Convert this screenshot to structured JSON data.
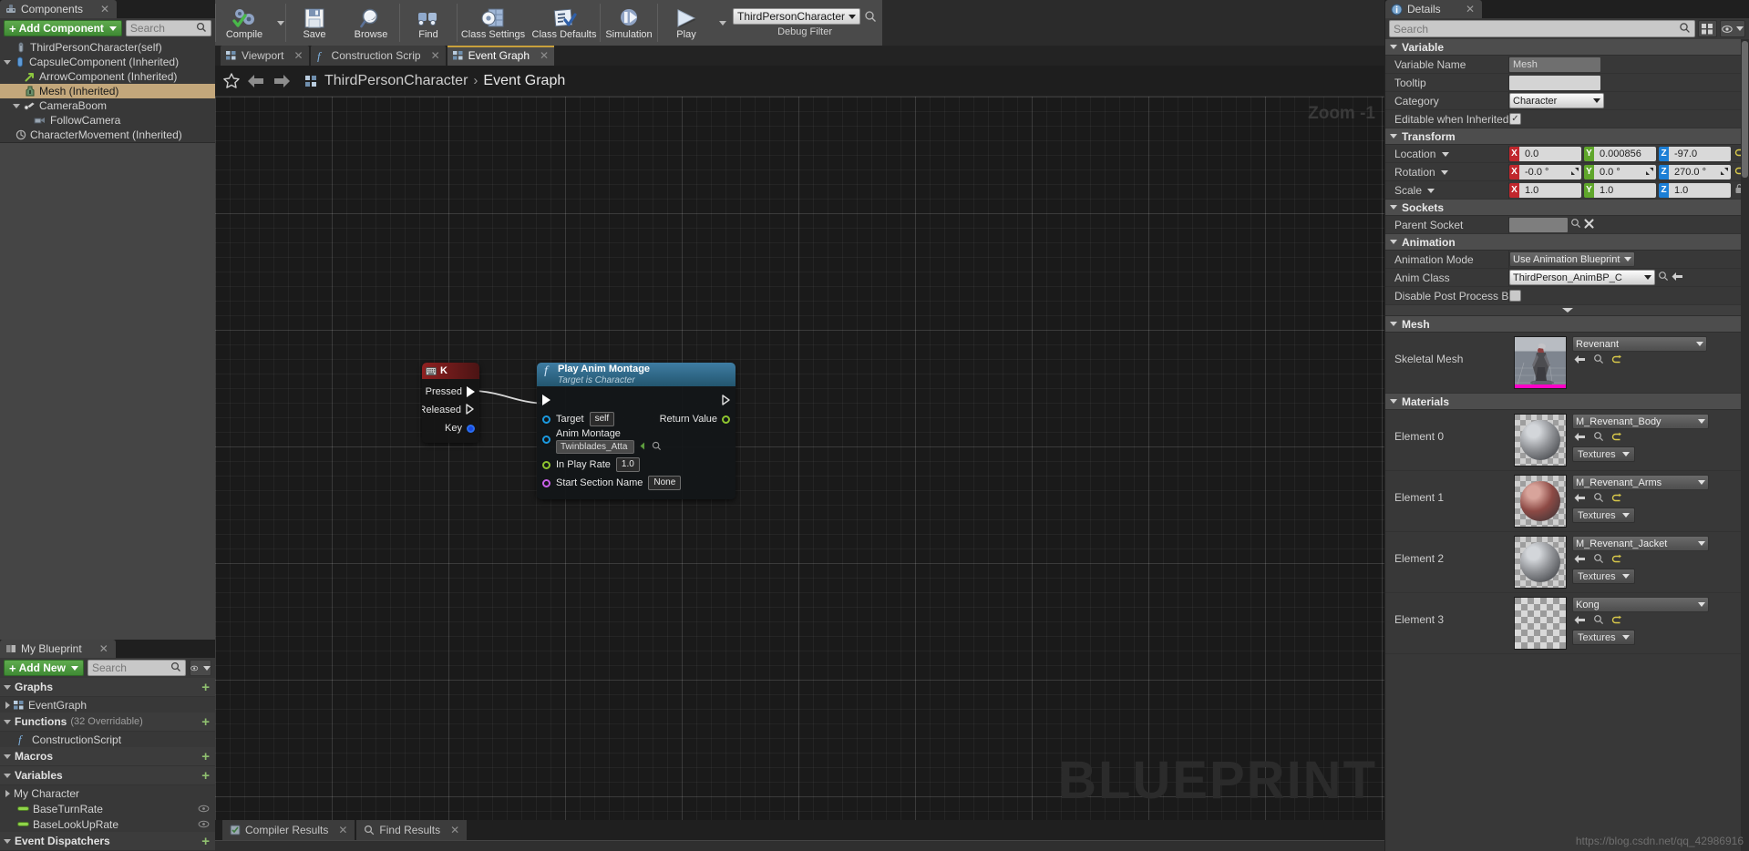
{
  "components_panel": {
    "tab_label": "Components",
    "add_component_label": "Add Component",
    "search_placeholder": "Search",
    "tree": [
      {
        "label": "ThirdPersonCharacter(self)",
        "icon": "blueprint-icon",
        "depth": 0,
        "expander": "none",
        "selected": false
      },
      {
        "label": "CapsuleComponent (Inherited)",
        "icon": "capsule-icon",
        "depth": 0,
        "expander": "down",
        "selected": false
      },
      {
        "label": "ArrowComponent (Inherited)",
        "icon": "arrow-icon",
        "depth": 1,
        "expander": "none",
        "selected": false
      },
      {
        "label": "Mesh (Inherited)",
        "icon": "mesh-icon",
        "depth": 1,
        "expander": "none",
        "selected": true
      },
      {
        "label": "CameraBoom",
        "icon": "spring-arm-icon",
        "depth": 1,
        "expander": "down",
        "selected": false
      },
      {
        "label": "FollowCamera",
        "icon": "camera-icon",
        "depth": 2,
        "expander": "none",
        "selected": false
      },
      {
        "label": "CharacterMovement (Inherited)",
        "icon": "movement-icon",
        "depth": 0,
        "expander": "none",
        "selected": false
      }
    ]
  },
  "my_blueprint_panel": {
    "tab_label": "My Blueprint",
    "add_new_label": "Add New",
    "search_placeholder": "Search",
    "sections": [
      {
        "title": "Graphs",
        "sub": "",
        "items": [
          {
            "label": "EventGraph",
            "icon": "graph-icon",
            "expander": "right",
            "trail": ""
          }
        ]
      },
      {
        "title": "Functions",
        "sub": "(32 Overridable)",
        "items": [
          {
            "label": "ConstructionScript",
            "icon": "function-icon",
            "expander": "none",
            "trail": ""
          }
        ]
      },
      {
        "title": "Macros",
        "sub": "",
        "items": []
      },
      {
        "title": "Variables",
        "sub": "",
        "items": [
          {
            "label": "My Character",
            "icon": "category-icon",
            "expander": "right",
            "trail": "",
            "category": true
          },
          {
            "label": "BaseTurnRate",
            "icon": "float-var-icon",
            "expander": "none",
            "trail": "eye-icon"
          },
          {
            "label": "BaseLookUpRate",
            "icon": "float-var-icon",
            "expander": "none",
            "trail": "eye-icon"
          }
        ]
      },
      {
        "title": "Event Dispatchers",
        "sub": "",
        "items": []
      }
    ]
  },
  "toolbar": {
    "items": [
      {
        "label": "Compile",
        "icon": "compile-icon",
        "has_dropdown": true
      },
      {
        "label": "Save",
        "icon": "save-icon",
        "has_dropdown": false
      },
      {
        "label": "Browse",
        "icon": "browse-icon",
        "has_dropdown": false
      },
      {
        "label": "Find",
        "icon": "find-icon",
        "has_dropdown": false
      },
      {
        "label": "Class Settings",
        "icon": "class-settings-icon",
        "has_dropdown": false
      },
      {
        "label": "Class Defaults",
        "icon": "class-defaults-icon",
        "has_dropdown": false
      },
      {
        "label": "Simulation",
        "icon": "simulation-icon",
        "has_dropdown": false
      },
      {
        "label": "Play",
        "icon": "play-icon",
        "has_dropdown": true
      }
    ],
    "debug_filter_value": "ThirdPersonCharacter",
    "debug_filter_label": "Debug Filter"
  },
  "graph_tabs": [
    {
      "label": "Viewport",
      "icon": "viewport-icon",
      "active": false
    },
    {
      "label": "Construction Scrip",
      "icon": "function-icon",
      "active": false
    },
    {
      "label": "Event Graph",
      "icon": "graph-icon",
      "active": true
    }
  ],
  "breadcrumb": {
    "root": "ThirdPersonCharacter",
    "separator": "›",
    "current": "Event Graph"
  },
  "canvas": {
    "zoom_label": "Zoom -1",
    "watermark": "BLUEPRINT"
  },
  "nodes": {
    "key_event": {
      "title": "K",
      "pins": [
        {
          "label": "Pressed",
          "type": "exec",
          "filled": true
        },
        {
          "label": "Released",
          "type": "exec",
          "filled": false
        },
        {
          "label": "Key",
          "type": "struct",
          "filled": true
        }
      ]
    },
    "play_anim_montage": {
      "title": "Play Anim Montage",
      "subtitle": "Target is Character",
      "inputs": [
        {
          "label": "Target",
          "value": "self",
          "kind": "object"
        },
        {
          "label": "Anim Montage",
          "value": "Twinblades_Atta",
          "kind": "object"
        },
        {
          "label": "In Play Rate",
          "value": "1.0",
          "kind": "float"
        },
        {
          "label": "Start Section Name",
          "value": "None",
          "kind": "name"
        }
      ],
      "outputs": [
        {
          "label": "Return Value",
          "kind": "float"
        }
      ]
    }
  },
  "bottom_tabs": [
    {
      "label": "Compiler Results",
      "icon": "compiler-icon"
    },
    {
      "label": "Find Results",
      "icon": "find-icon"
    }
  ],
  "details_panel": {
    "tab_label": "Details",
    "search_placeholder": "Search",
    "sections": [
      {
        "title": "Variable",
        "rows": [
          {
            "name": "Variable Name",
            "kind": "text",
            "value": "Mesh"
          },
          {
            "name": "Tooltip",
            "kind": "text-light",
            "value": ""
          },
          {
            "name": "Category",
            "kind": "combo-light",
            "value": "Character"
          },
          {
            "name": "Editable when Inherited",
            "kind": "checkbox",
            "value": "checked"
          }
        ]
      },
      {
        "title": "Transform",
        "rows": [
          {
            "name": "Location",
            "kind": "vector",
            "has_dropdown": true,
            "x": "0.0",
            "y": "0.000856",
            "z": "-97.0",
            "trailing": "revert"
          },
          {
            "name": "Rotation",
            "kind": "vector",
            "has_dropdown": true,
            "x": "-0.0 °",
            "y": "0.0 °",
            "z": "270.0 °",
            "trailing": "revert",
            "spinner": true
          },
          {
            "name": "Scale",
            "kind": "vector",
            "has_dropdown": true,
            "x": "1.0",
            "y": "1.0",
            "z": "1.0",
            "trailing": "lock"
          }
        ]
      },
      {
        "title": "Sockets",
        "rows": [
          {
            "name": "Parent Socket",
            "kind": "socket",
            "value": ""
          }
        ]
      },
      {
        "title": "Animation",
        "rows": [
          {
            "name": "Animation Mode",
            "kind": "combo-grey",
            "value": "Use Animation Blueprint"
          },
          {
            "name": "Anim Class",
            "kind": "asset-combo",
            "value": "ThirdPerson_AnimBP_C"
          },
          {
            "name": "Disable Post Process Blueprir",
            "kind": "checkbox-off",
            "value": "unchecked"
          }
        ]
      },
      {
        "title": "Mesh",
        "rows": [
          {
            "name": "Skeletal Mesh",
            "kind": "asset-thumb",
            "value": "Revenant",
            "thumb": "character-thumb"
          }
        ]
      },
      {
        "title": "Materials",
        "rows": [
          {
            "name": "Element 0",
            "kind": "material",
            "value": "M_Revenant_Body",
            "textures_label": "Textures",
            "thumb": "sphere-thumb-grey"
          },
          {
            "name": "Element 1",
            "kind": "material",
            "value": "M_Revenant_Arms",
            "textures_label": "Textures",
            "thumb": "sphere-thumb-red"
          },
          {
            "name": "Element 2",
            "kind": "material",
            "value": "M_Revenant_Jacket",
            "textures_label": "Textures",
            "thumb": "sphere-thumb-grey"
          },
          {
            "name": "Element 3",
            "kind": "material",
            "value": "Kong",
            "textures_label": "Textures",
            "thumb": "checker-thumb"
          }
        ]
      }
    ]
  },
  "watermark_credit": "https://blog.csdn.net/qq_42986916"
}
